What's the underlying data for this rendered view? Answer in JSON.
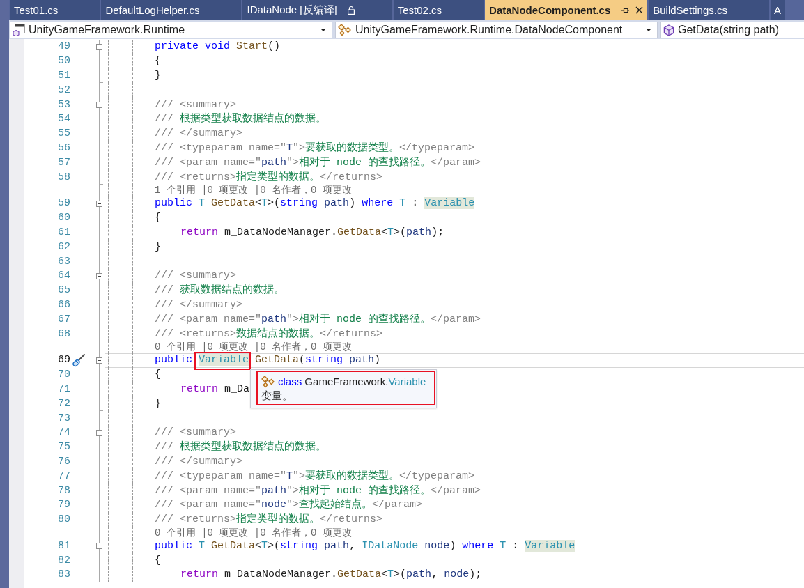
{
  "tabs": [
    {
      "label": "Test01.cs",
      "selected": false,
      "locked": false
    },
    {
      "label": "DefaultLogHelper.cs",
      "selected": false,
      "locked": false
    },
    {
      "label": "IDataNode [反编译]",
      "selected": false,
      "locked": true
    },
    {
      "label": "Test02.cs",
      "selected": false,
      "locked": false
    },
    {
      "label": "DataNodeComponent.cs",
      "selected": true,
      "locked": false
    },
    {
      "label": "BuildSettings.cs",
      "selected": false,
      "locked": false
    },
    {
      "label": "A",
      "selected": false,
      "locked": false
    }
  ],
  "navigation": [
    {
      "kind": "project",
      "text": "UnityGameFramework.Runtime"
    },
    {
      "kind": "type",
      "text": "UnityGameFramework.Runtime.DataNodeComponent"
    },
    {
      "kind": "member",
      "text": "GetData(string path)"
    }
  ],
  "editor": {
    "lines": [
      {
        "number": "49",
        "kind": "block-start",
        "current": false,
        "expanded": true,
        "tokens": [
          {
            "kind": "keyword",
            "text": "private "
          },
          {
            "kind": "keyword",
            "text": "void "
          },
          {
            "kind": "method",
            "text": "Start"
          },
          {
            "kind": "plain",
            "text": "()"
          }
        ]
      },
      {
        "number": "50",
        "kind": "code",
        "current": false,
        "tokens": [
          {
            "kind": "plain",
            "text": "{"
          }
        ]
      },
      {
        "number": "51",
        "kind": "block-end",
        "current": false,
        "tokens": [
          {
            "kind": "plain",
            "text": "}"
          }
        ]
      },
      {
        "number": "52",
        "kind": "blank",
        "current": false
      },
      {
        "number": "53",
        "kind": "block-start",
        "current": false,
        "expanded": true,
        "tokens": [
          {
            "kind": "doc",
            "text": "/// <summary>"
          }
        ]
      },
      {
        "number": "54",
        "kind": "code",
        "current": false,
        "tokens": [
          {
            "kind": "doc",
            "text": "/// "
          },
          {
            "kind": "doc-text",
            "text": "根据类型获取数据结点的数据。"
          }
        ]
      },
      {
        "number": "55",
        "kind": "code",
        "current": false,
        "tokens": [
          {
            "kind": "doc",
            "text": "/// </summary>"
          }
        ]
      },
      {
        "number": "56",
        "kind": "code",
        "current": false,
        "tokens": [
          {
            "kind": "doc",
            "text": "/// <typeparam name=\""
          },
          {
            "kind": "doc-attr",
            "text": "T"
          },
          {
            "kind": "doc",
            "text": "\">"
          },
          {
            "kind": "doc-text",
            "text": "要获取的数据类型。"
          },
          {
            "kind": "doc",
            "text": "</typeparam>"
          }
        ]
      },
      {
        "number": "57",
        "kind": "code",
        "current": false,
        "tokens": [
          {
            "kind": "doc",
            "text": "/// <param name=\""
          },
          {
            "kind": "doc-attr",
            "text": "path"
          },
          {
            "kind": "doc",
            "text": "\">"
          },
          {
            "kind": "doc-text",
            "text": "相对于 node 的查找路径。"
          },
          {
            "kind": "doc",
            "text": "</param>"
          }
        ]
      },
      {
        "number": "58",
        "kind": "block-end",
        "current": false,
        "tokens": [
          {
            "kind": "doc",
            "text": "/// <returns>"
          },
          {
            "kind": "doc-text",
            "text": "指定类型的数据。"
          },
          {
            "kind": "doc",
            "text": "</returns>"
          }
        ]
      },
      {
        "kind": "lens",
        "text": "1 个引用 |0 项更改 |0 名作者，0 项更改"
      },
      {
        "number": "59",
        "kind": "block-start",
        "current": false,
        "expanded": true,
        "tokens": [
          {
            "kind": "keyword",
            "text": "public "
          },
          {
            "kind": "type",
            "text": "T "
          },
          {
            "kind": "method",
            "text": "GetData"
          },
          {
            "kind": "plain",
            "text": "<"
          },
          {
            "kind": "type",
            "text": "T"
          },
          {
            "kind": "plain",
            "text": ">("
          },
          {
            "kind": "keyword",
            "text": "string "
          },
          {
            "kind": "parameter",
            "text": "path"
          },
          {
            "kind": "plain",
            "text": ") "
          },
          {
            "kind": "keyword",
            "text": "where "
          },
          {
            "kind": "type",
            "text": "T"
          },
          {
            "kind": "plain",
            "text": " : "
          },
          {
            "kind": "reference",
            "text": "Variable"
          }
        ]
      },
      {
        "number": "60",
        "kind": "code",
        "current": false,
        "tokens": [
          {
            "kind": "plain",
            "text": "{"
          }
        ]
      },
      {
        "number": "61",
        "kind": "statement",
        "current": false,
        "tokens": [
          {
            "kind": "control",
            "text": "return "
          },
          {
            "kind": "plain",
            "text": "m_DataNodeManager."
          },
          {
            "kind": "method",
            "text": "GetData"
          },
          {
            "kind": "plain",
            "text": "<"
          },
          {
            "kind": "type",
            "text": "T"
          },
          {
            "kind": "plain",
            "text": ">("
          },
          {
            "kind": "parameter",
            "text": "path"
          },
          {
            "kind": "plain",
            "text": ");"
          }
        ]
      },
      {
        "number": "62",
        "kind": "block-end",
        "current": false,
        "tokens": [
          {
            "kind": "plain",
            "text": "}"
          }
        ]
      },
      {
        "number": "63",
        "kind": "blank",
        "current": false
      },
      {
        "number": "64",
        "kind": "block-start",
        "current": false,
        "expanded": true,
        "tokens": [
          {
            "kind": "doc",
            "text": "/// <summary>"
          }
        ]
      },
      {
        "number": "65",
        "kind": "code",
        "current": false,
        "tokens": [
          {
            "kind": "doc",
            "text": "/// "
          },
          {
            "kind": "doc-text",
            "text": "获取数据结点的数据。"
          }
        ]
      },
      {
        "number": "66",
        "kind": "code",
        "current": false,
        "tokens": [
          {
            "kind": "doc",
            "text": "/// </summary>"
          }
        ]
      },
      {
        "number": "67",
        "kind": "code",
        "current": false,
        "tokens": [
          {
            "kind": "doc",
            "text": "/// <param name=\""
          },
          {
            "kind": "doc-attr",
            "text": "path"
          },
          {
            "kind": "doc",
            "text": "\">"
          },
          {
            "kind": "doc-text",
            "text": "相对于 node 的查找路径。"
          },
          {
            "kind": "doc",
            "text": "</param>"
          }
        ]
      },
      {
        "number": "68",
        "kind": "block-end",
        "current": false,
        "tokens": [
          {
            "kind": "doc",
            "text": "/// <returns>"
          },
          {
            "kind": "doc-text",
            "text": "数据结点的数据。"
          },
          {
            "kind": "doc",
            "text": "</returns>"
          }
        ]
      },
      {
        "kind": "lens",
        "text": "0 个引用 |0 项更改 |0 名作者，0 项更改"
      },
      {
        "number": "69",
        "kind": "block-start",
        "current": true,
        "expanded": true,
        "tokens": [
          {
            "kind": "keyword",
            "text": "public "
          },
          {
            "kind": "framed-reference",
            "text": "Variable"
          },
          {
            "kind": "method",
            "text": " GetData"
          },
          {
            "kind": "plain",
            "text": "("
          },
          {
            "kind": "keyword",
            "text": "string "
          },
          {
            "kind": "parameter",
            "text": "path"
          },
          {
            "kind": "plain",
            "text": ")"
          }
        ],
        "tooltip": {
          "framed": true,
          "signature": [
            {
              "kind": "keyword",
              "text": "class"
            },
            {
              "kind": "plain",
              "text": " GameFramework."
            },
            {
              "kind": "type",
              "text": "Variable"
            }
          ],
          "description": "变量。"
        }
      },
      {
        "number": "70",
        "kind": "code",
        "current": false,
        "tokens": [
          {
            "kind": "plain",
            "text": "{"
          }
        ]
      },
      {
        "number": "71",
        "kind": "statement",
        "current": false,
        "tokens": [
          {
            "kind": "control",
            "text": "return "
          },
          {
            "kind": "plain",
            "text": "m_Da"
          }
        ]
      },
      {
        "number": "72",
        "kind": "block-end",
        "current": false,
        "tokens": [
          {
            "kind": "plain",
            "text": "}"
          }
        ]
      },
      {
        "number": "73",
        "kind": "blank",
        "current": false
      },
      {
        "number": "74",
        "kind": "block-start",
        "current": false,
        "expanded": true,
        "tokens": [
          {
            "kind": "doc",
            "text": "/// <summary>"
          }
        ]
      },
      {
        "number": "75",
        "kind": "code",
        "current": false,
        "tokens": [
          {
            "kind": "doc",
            "text": "/// "
          },
          {
            "kind": "doc-text",
            "text": "根据类型获取数据结点的数据。"
          }
        ]
      },
      {
        "number": "76",
        "kind": "code",
        "current": false,
        "tokens": [
          {
            "kind": "doc",
            "text": "/// </summary>"
          }
        ]
      },
      {
        "number": "77",
        "kind": "code",
        "current": false,
        "tokens": [
          {
            "kind": "doc",
            "text": "/// <typeparam name=\""
          },
          {
            "kind": "doc-attr",
            "text": "T"
          },
          {
            "kind": "doc",
            "text": "\">"
          },
          {
            "kind": "doc-text",
            "text": "要获取的数据类型。"
          },
          {
            "kind": "doc",
            "text": "</typeparam>"
          }
        ]
      },
      {
        "number": "78",
        "kind": "code",
        "current": false,
        "tokens": [
          {
            "kind": "doc",
            "text": "/// <param name=\""
          },
          {
            "kind": "doc-attr",
            "text": "path"
          },
          {
            "kind": "doc",
            "text": "\">"
          },
          {
            "kind": "doc-text",
            "text": "相对于 node 的查找路径。"
          },
          {
            "kind": "doc",
            "text": "</param>"
          }
        ]
      },
      {
        "number": "79",
        "kind": "code",
        "current": false,
        "tokens": [
          {
            "kind": "doc",
            "text": "/// <param name=\""
          },
          {
            "kind": "doc-attr",
            "text": "node"
          },
          {
            "kind": "doc",
            "text": "\">"
          },
          {
            "kind": "doc-text",
            "text": "查找起始结点。"
          },
          {
            "kind": "doc",
            "text": "</param>"
          }
        ]
      },
      {
        "number": "80",
        "kind": "block-end",
        "current": false,
        "tokens": [
          {
            "kind": "doc",
            "text": "/// <returns>"
          },
          {
            "kind": "doc-text",
            "text": "指定类型的数据。"
          },
          {
            "kind": "doc",
            "text": "</returns>"
          }
        ]
      },
      {
        "kind": "lens",
        "text": "0 个引用 |0 项更改 |0 名作者，0 项更改"
      },
      {
        "number": "81",
        "kind": "block-start",
        "current": false,
        "expanded": true,
        "tokens": [
          {
            "kind": "keyword",
            "text": "public "
          },
          {
            "kind": "type",
            "text": "T "
          },
          {
            "kind": "method",
            "text": "GetData"
          },
          {
            "kind": "plain",
            "text": "<"
          },
          {
            "kind": "type",
            "text": "T"
          },
          {
            "kind": "plain",
            "text": ">("
          },
          {
            "kind": "keyword",
            "text": "string "
          },
          {
            "kind": "parameter",
            "text": "path"
          },
          {
            "kind": "plain",
            "text": ", "
          },
          {
            "kind": "type",
            "text": "IDataNode "
          },
          {
            "kind": "parameter",
            "text": "node"
          },
          {
            "kind": "plain",
            "text": ") "
          },
          {
            "kind": "keyword",
            "text": "where "
          },
          {
            "kind": "type",
            "text": "T"
          },
          {
            "kind": "plain",
            "text": " : "
          },
          {
            "kind": "reference",
            "text": "Variable"
          }
        ]
      },
      {
        "number": "82",
        "kind": "code",
        "current": false,
        "tokens": [
          {
            "kind": "plain",
            "text": "{"
          }
        ]
      },
      {
        "number": "83",
        "kind": "statement",
        "current": false,
        "tokens": [
          {
            "kind": "control",
            "text": "return "
          },
          {
            "kind": "plain",
            "text": "m_DataNodeManager."
          },
          {
            "kind": "method",
            "text": "GetData"
          },
          {
            "kind": "plain",
            "text": "<"
          },
          {
            "kind": "type",
            "text": "T"
          },
          {
            "kind": "plain",
            "text": ">("
          },
          {
            "kind": "parameter",
            "text": "path"
          },
          {
            "kind": "plain",
            "text": ", "
          },
          {
            "kind": "parameter",
            "text": "node"
          },
          {
            "kind": "plain",
            "text": ");"
          }
        ]
      }
    ]
  }
}
